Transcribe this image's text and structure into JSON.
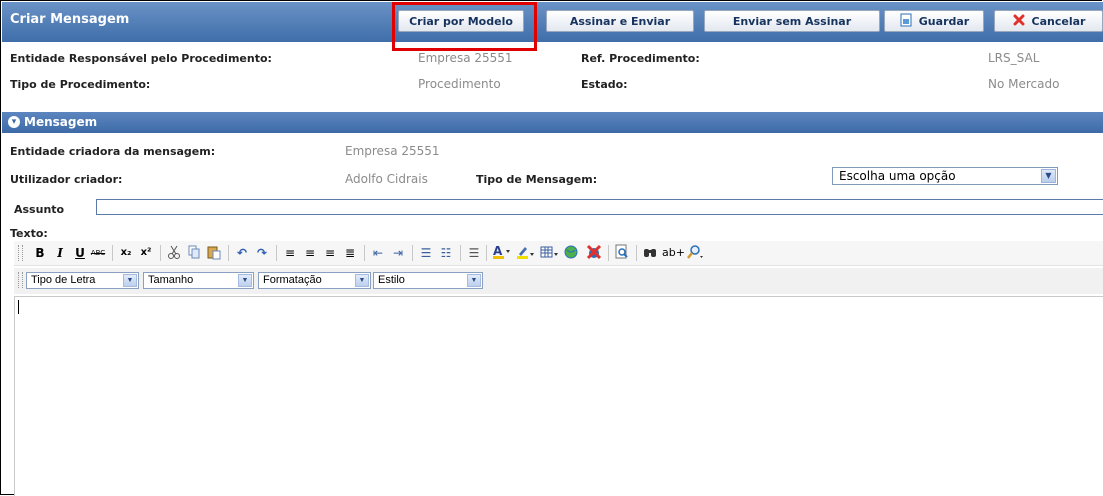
{
  "header": {
    "title": "Criar Mensagem",
    "buttons": {
      "template": "Criar por Modelo",
      "sign_send": "Assinar e Enviar",
      "send_unsigned": "Enviar sem Assinar",
      "save": "Guardar",
      "cancel": "Cancelar"
    }
  },
  "procedure": {
    "entity_label": "Entidade Responsável pelo Procedimento:",
    "entity_value": "Empresa 25551",
    "ref_label": "Ref. Procedimento:",
    "ref_value": "LRS_SAL",
    "type_label": "Tipo de Procedimento:",
    "type_value": "Procedimento",
    "state_label": "Estado:",
    "state_value": "No Mercado"
  },
  "message": {
    "section_title": "Mensagem",
    "creator_entity_label": "Entidade criadora da mensagem:",
    "creator_entity_value": "Empresa 25551",
    "creator_user_label": "Utilizador criador:",
    "creator_user_value": "Adolfo Cidrais",
    "msg_type_label": "Tipo de Mensagem:",
    "msg_type_value": "Escolha uma opção",
    "subject_label": "Assunto",
    "subject_value": "",
    "text_label": "Texto:"
  },
  "editor": {
    "dropdowns": {
      "font": "Tipo de Letra",
      "size": "Tamanho",
      "format": "Formatação",
      "style": "Estilo"
    },
    "glyphs": {
      "bold": "B",
      "italic": "I",
      "underline": "U",
      "strike": "ABC",
      "sub": "x₂",
      "sup": "x²",
      "abplus": "ab+"
    }
  },
  "colors": {
    "header_blue": "#4a78b4",
    "highlight_red": "#e00000"
  }
}
